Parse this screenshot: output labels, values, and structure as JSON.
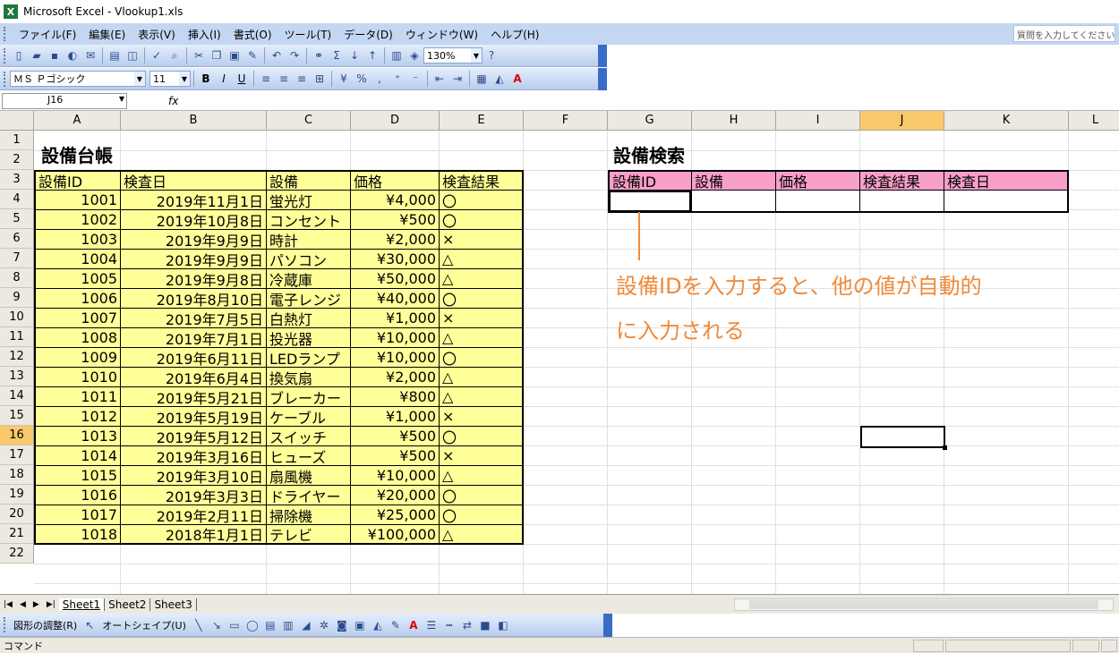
{
  "window": {
    "title": "Microsoft Excel - Vlookup1.xls"
  },
  "menu": {
    "items": [
      "ファイル(F)",
      "編集(E)",
      "表示(V)",
      "挿入(I)",
      "書式(O)",
      "ツール(T)",
      "データ(D)",
      "ウィンドウ(W)",
      "ヘルプ(H)"
    ],
    "help_placeholder": "質問を入力してください"
  },
  "toolbar": {
    "zoom": "130%",
    "font_name": "ＭＳ Ｐゴシック",
    "font_size": "11"
  },
  "formula_bar": {
    "name_box": "J16",
    "fx": "fx",
    "value": ""
  },
  "columns": [
    "A",
    "B",
    "C",
    "D",
    "E",
    "F",
    "G",
    "H",
    "I",
    "J",
    "K",
    "L"
  ],
  "rows": [
    "1",
    "2",
    "3",
    "4",
    "5",
    "6",
    "7",
    "8",
    "9",
    "10",
    "11",
    "12",
    "13",
    "14",
    "15",
    "16",
    "17",
    "18",
    "19",
    "20",
    "21",
    "22"
  ],
  "ledger": {
    "title": "設備台帳",
    "headers": [
      "設備ID",
      "検査日",
      "設備",
      "価格",
      "検査結果"
    ],
    "rows": [
      [
        "1001",
        "2019年11月1日",
        "蛍光灯",
        "¥4,000",
        "〇"
      ],
      [
        "1002",
        "2019年10月8日",
        "コンセント",
        "¥500",
        "〇"
      ],
      [
        "1003",
        "2019年9月9日",
        "時計",
        "¥2,000",
        "×"
      ],
      [
        "1004",
        "2019年9月9日",
        "パソコン",
        "¥30,000",
        "△"
      ],
      [
        "1005",
        "2019年9月8日",
        "冷蔵庫",
        "¥50,000",
        "△"
      ],
      [
        "1006",
        "2019年8月10日",
        "電子レンジ",
        "¥40,000",
        "〇"
      ],
      [
        "1007",
        "2019年7月5日",
        "白熱灯",
        "¥1,000",
        "×"
      ],
      [
        "1008",
        "2019年7月1日",
        "投光器",
        "¥10,000",
        "△"
      ],
      [
        "1009",
        "2019年6月11日",
        "LEDランプ",
        "¥10,000",
        "〇"
      ],
      [
        "1010",
        "2019年6月4日",
        "換気扇",
        "¥2,000",
        "△"
      ],
      [
        "1011",
        "2019年5月21日",
        "ブレーカー",
        "¥800",
        "△"
      ],
      [
        "1012",
        "2019年5月19日",
        "ケーブル",
        "¥1,000",
        "×"
      ],
      [
        "1013",
        "2019年5月12日",
        "スイッチ",
        "¥500",
        "〇"
      ],
      [
        "1014",
        "2019年3月16日",
        "ヒューズ",
        "¥500",
        "×"
      ],
      [
        "1015",
        "2019年3月10日",
        "扇風機",
        "¥10,000",
        "△"
      ],
      [
        "1016",
        "2019年3月3日",
        "ドライヤー",
        "¥20,000",
        "〇"
      ],
      [
        "1017",
        "2019年2月11日",
        "掃除機",
        "¥25,000",
        "〇"
      ],
      [
        "1018",
        "2018年1月1日",
        "テレビ",
        "¥100,000",
        "△"
      ]
    ]
  },
  "search": {
    "title": "設備検索",
    "headers": [
      "設備ID",
      "設備",
      "価格",
      "検査結果",
      "検査日"
    ]
  },
  "annotation": {
    "line1": "設備IDを入力すると、他の値が自動的",
    "line2": "に入力される"
  },
  "sheets": [
    "Sheet1",
    "Sheet2",
    "Sheet3"
  ],
  "draw_toolbar": {
    "draw_label": "図形の調整(R)",
    "autoshape_label": "オートシェイプ(U)"
  },
  "status": "コマンド",
  "colors": {
    "ledger_fill": "#ffff99",
    "search_header_fill": "#f79fc9",
    "annotation": "#ef8a3a",
    "selected_header": "#f8c86b"
  }
}
